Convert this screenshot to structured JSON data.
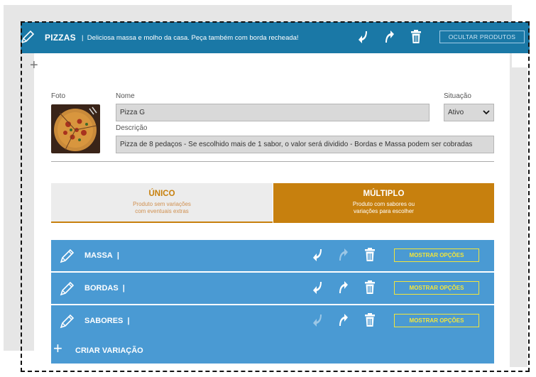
{
  "category": {
    "title": "PIZZAS",
    "separator": "|",
    "description": "Deliciosa massa e molho da casa. Peça também com borda recheada!",
    "hide_products_label": "OCULTAR PRODUTOS"
  },
  "form": {
    "photo_label": "Foto",
    "name_label": "Nome",
    "name_value": "Pizza G",
    "status_label": "Situação",
    "status_value": "Ativo",
    "description_label": "Descrição",
    "description_value": "Pizza de 8 pedaços - Se escolhido mais de 1 sabor, o valor será dividido - Bordas e Massa podem ser cobradas"
  },
  "tabs": [
    {
      "title": "ÚNICO",
      "subtitle_line1": "Produto sem variações",
      "subtitle_line2": "com eventuais extras"
    },
    {
      "title": "MÚLTIPLO",
      "subtitle_line1": "Produto com sabores ou",
      "subtitle_line2": "variações para escolher"
    }
  ],
  "variations": [
    {
      "name": "MASSA",
      "separator": "|",
      "show_options_label": "MOSTRAR OPÇÕES"
    },
    {
      "name": "BORDAS",
      "separator": "|",
      "show_options_label": "MOSTRAR OPÇÕES"
    },
    {
      "name": "SABORES",
      "separator": "|",
      "show_options_label": "MOSTRAR OPÇÕES"
    }
  ],
  "add_variation_label": "CRIAR VARIAÇÃO",
  "colors": {
    "category_bar": "#1a78a6",
    "variation_bar": "#4a9ad3",
    "accent_orange": "#c7800e",
    "show_options_yellow": "#f2e53a"
  },
  "icons": [
    "pencil-icon",
    "arrow-down-icon",
    "arrow-up-icon",
    "trash-icon",
    "plus-icon",
    "chevron-down-icon"
  ]
}
